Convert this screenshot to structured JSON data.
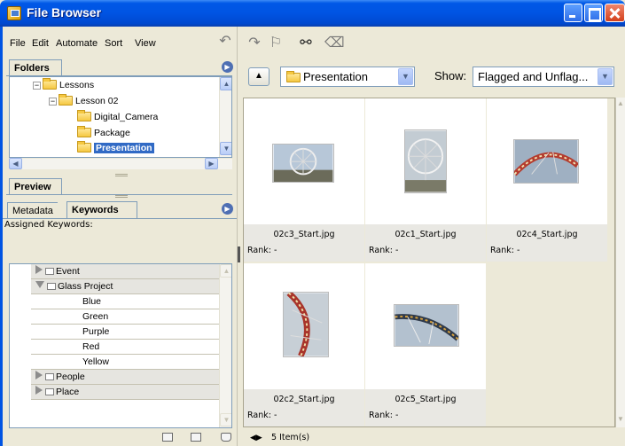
{
  "window": {
    "title": "File Browser"
  },
  "menu": [
    "File",
    "Edit",
    "Automate",
    "Sort",
    "View"
  ],
  "folders_pane": {
    "tab_label": "Folders",
    "tree": [
      {
        "label": "Lessons",
        "expanded": true
      },
      {
        "label": "Lesson 02",
        "expanded": true
      },
      {
        "label": "Digital_Camera"
      },
      {
        "label": "Package"
      },
      {
        "label": "Presentation",
        "selected": true
      }
    ]
  },
  "preview_pane": {
    "tab_label": "Preview"
  },
  "keywords_pane": {
    "tabs": [
      "Metadata",
      "Keywords"
    ],
    "assigned_label": "Assigned Keywords:",
    "items": [
      {
        "label": "Event",
        "type": "category"
      },
      {
        "label": "Glass Project",
        "type": "category",
        "expanded": true
      },
      {
        "label": "Blue",
        "type": "keyword"
      },
      {
        "label": "Green",
        "type": "keyword"
      },
      {
        "label": "Purple",
        "type": "keyword"
      },
      {
        "label": "Red",
        "type": "keyword"
      },
      {
        "label": "Yellow",
        "type": "keyword"
      },
      {
        "label": "People",
        "type": "category"
      },
      {
        "label": "Place",
        "type": "category"
      }
    ]
  },
  "location": {
    "folder": "Presentation",
    "show_label": "Show:",
    "show_value": "Flagged and Unflag..."
  },
  "thumbnails": [
    {
      "filename": "02c3_Start.jpg",
      "rank": "Rank: -"
    },
    {
      "filename": "02c1_Start.jpg",
      "rank": "Rank: -"
    },
    {
      "filename": "02c4_Start.jpg",
      "rank": "Rank: -"
    },
    {
      "filename": "02c2_Start.jpg",
      "rank": "Rank: -"
    },
    {
      "filename": "02c5_Start.jpg",
      "rank": "Rank: -"
    }
  ],
  "status": {
    "count": "5 Item(s)"
  },
  "colors": {
    "titlebar": "#0054e3",
    "selection": "#316ac5",
    "panel": "#ece9d8"
  }
}
